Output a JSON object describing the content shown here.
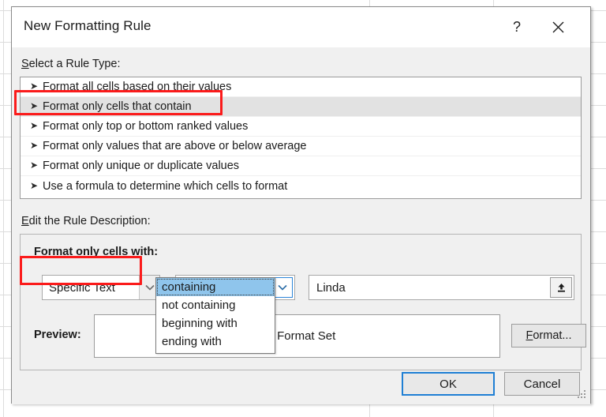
{
  "dialog": {
    "title": "New Formatting Rule",
    "help_icon": "question-mark-icon",
    "close_icon": "close-icon"
  },
  "rule_type_section": {
    "label_accel": "S",
    "label_rest": "elect a Rule Type:",
    "bullet_glyph": "➤",
    "items": [
      {
        "label": "Format all cells based on their values",
        "selected": false
      },
      {
        "label": "Format only cells that contain",
        "selected": true
      },
      {
        "label": "Format only top or bottom ranked values",
        "selected": false
      },
      {
        "label": "Format only values that are above or below average",
        "selected": false
      },
      {
        "label": "Format only unique or duplicate values",
        "selected": false
      },
      {
        "label": "Use a formula to determine which cells to format",
        "selected": false
      }
    ]
  },
  "description_section": {
    "label_accel": "E",
    "label_rest": "dit the Rule Description:",
    "sub_label_pre": "F",
    "sub_label_accel": "o",
    "sub_label_rest": "rmat only cells with:",
    "rule_type_combo": {
      "value": "Specific Text",
      "arrow_icon": "chevron-down-icon"
    },
    "operator_combo": {
      "value": "containing",
      "arrow_icon": "chevron-down-icon",
      "open": true,
      "options": [
        {
          "label": "containing",
          "highlighted": true
        },
        {
          "label": "not containing",
          "highlighted": false
        },
        {
          "label": "beginning with",
          "highlighted": false
        },
        {
          "label": "ending with",
          "highlighted": false
        }
      ]
    },
    "value_field": {
      "value": "Linda",
      "picker_icon": "range-selector-icon"
    },
    "preview_label": "Preview:",
    "preview_text": "No Format Set",
    "format_button": {
      "accel": "F",
      "rest": "ormat..."
    }
  },
  "footer": {
    "ok_label": "OK",
    "cancel_label": "Cancel"
  },
  "annotations": {
    "accent_color": "#fb1b1b",
    "box1_target": "Format only cells that contain",
    "box2_target": "Specific Text"
  }
}
